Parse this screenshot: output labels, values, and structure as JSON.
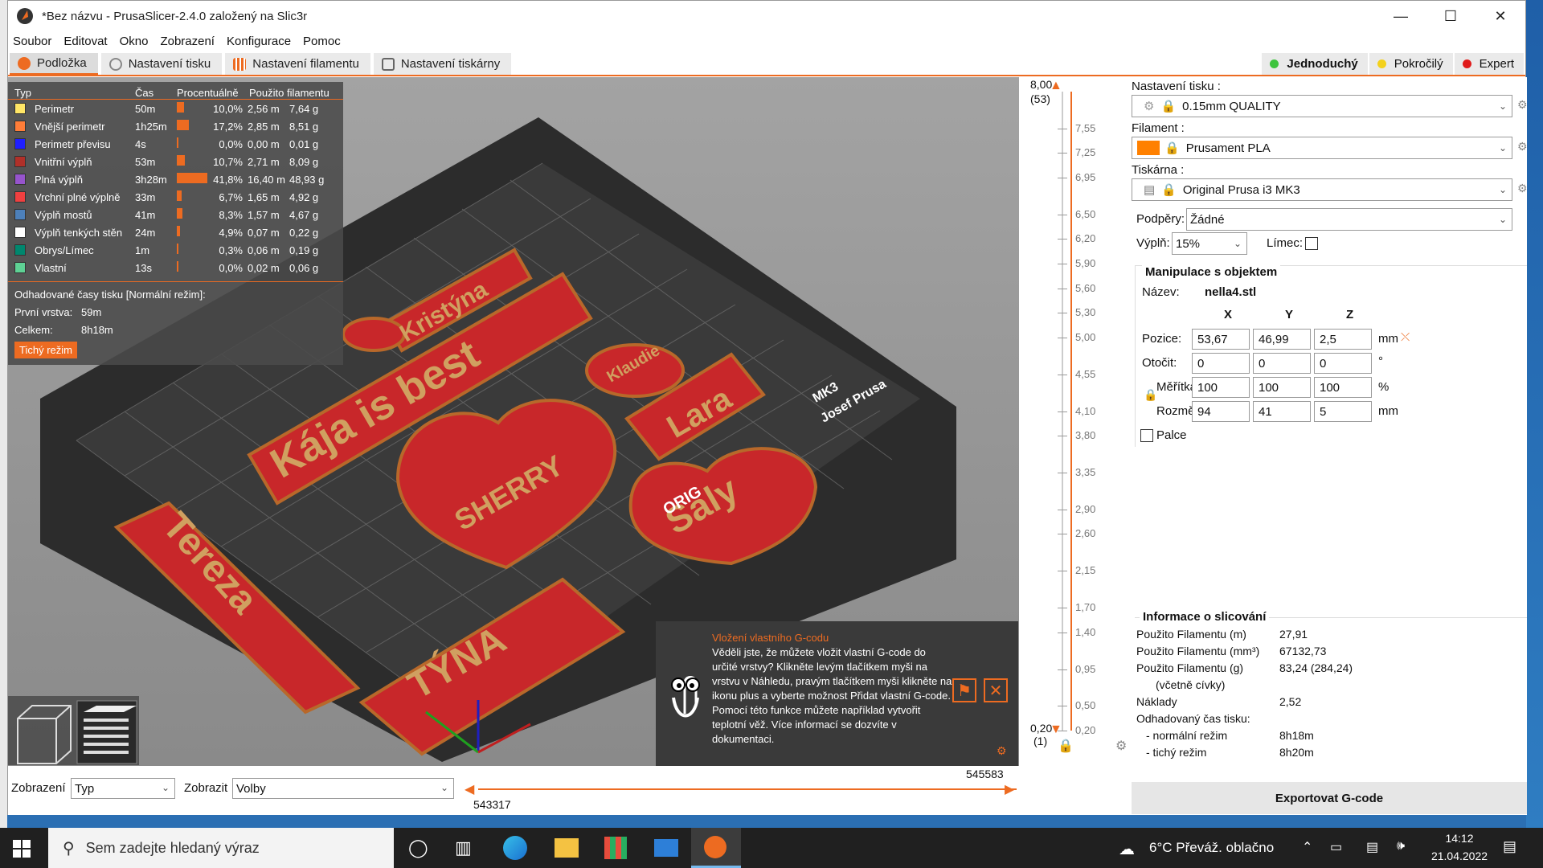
{
  "window": {
    "title": "*Bez názvu - PrusaSlicer-2.4.0 založený na Slic3r"
  },
  "menu": [
    "Soubor",
    "Editovat",
    "Okno",
    "Zobrazení",
    "Konfigurace",
    "Pomoc"
  ],
  "tabs": [
    "Podložka",
    "Nastavení tisku",
    "Nastavení filamentu",
    "Nastavení tiskárny"
  ],
  "modes": [
    {
      "label": "Jednoduchý",
      "color": "#3ec43e"
    },
    {
      "label": "Pokročilý",
      "color": "#f3d11c"
    },
    {
      "label": "Expert",
      "color": "#e01b1b"
    }
  ],
  "legend": {
    "headers": [
      "Typ",
      "Čas",
      "Procentuálně",
      "Použito filamentu"
    ],
    "rows": [
      {
        "type": "Perimetr",
        "color": "#ffe666",
        "time": "50m",
        "pct": "10,0%",
        "pct_value": 10.0,
        "length": "2,56 m",
        "weight": "7,64 g"
      },
      {
        "type": "Vnější perimetr",
        "color": "#ff7d38",
        "time": "1h25m",
        "pct": "17,2%",
        "pct_value": 17.2,
        "length": "2,85 m",
        "weight": "8,51 g"
      },
      {
        "type": "Perimetr převisu",
        "color": "#1f1fff",
        "time": "4s",
        "pct": "0,0%",
        "pct_value": 0.0,
        "length": "0,00 m",
        "weight": "0,01 g"
      },
      {
        "type": "Vnitřní výplň",
        "color": "#b03029",
        "time": "53m",
        "pct": "10,7%",
        "pct_value": 10.7,
        "length": "2,71 m",
        "weight": "8,09 g"
      },
      {
        "type": "Plná výplň",
        "color": "#9654cc",
        "time": "3h28m",
        "pct": "41,8%",
        "pct_value": 41.8,
        "length": "16,40 m",
        "weight": "48,93 g"
      },
      {
        "type": "Vrchní plné výplně",
        "color": "#f04040",
        "time": "33m",
        "pct": "6,7%",
        "pct_value": 6.7,
        "length": "1,65 m",
        "weight": "4,92 g"
      },
      {
        "type": "Výplň mostů",
        "color": "#4d80ba",
        "time": "41m",
        "pct": "8,3%",
        "pct_value": 8.3,
        "length": "1,57 m",
        "weight": "4,67 g"
      },
      {
        "type": "Výplň tenkých stěn",
        "color": "#ffffff",
        "time": "24m",
        "pct": "4,9%",
        "pct_value": 4.9,
        "length": "0,07 m",
        "weight": "0,22 g"
      },
      {
        "type": "Obrys/Límec",
        "color": "#00876e",
        "time": "1m",
        "pct": "0,3%",
        "pct_value": 0.3,
        "length": "0,06 m",
        "weight": "0,19 g"
      },
      {
        "type": "Vlastní",
        "color": "#5ed194",
        "time": "13s",
        "pct": "0,0%",
        "pct_value": 0.0,
        "length": "0,02 m",
        "weight": "0,06 g"
      }
    ],
    "est_title": "Odhadované časy tisku [Normální režim]:",
    "first_layer_label": "První vrstva:",
    "first_layer_value": "59m",
    "total_label": "Celkem:",
    "total_value": "8h18m",
    "silent_button": "Tichý režim"
  },
  "scene_labels": [
    "Kristýna",
    "Kája is best",
    "Klaudie",
    "Lara",
    "SHERRY",
    "Saly",
    "Tereza",
    "TÝNA",
    "MK3",
    "Josef Prusa",
    "ORIG"
  ],
  "tip": {
    "title": "Vložení vlastního G-codu",
    "text": "Věděli jste, že můžete vložit vlastní G-code do určité vrstvy? Klikněte levým tlačítkem myši na vrstvu v Náhledu, pravým tlačítkem myši klikněte na ikonu plus a vyberte možnost Přidat vlastní G-code. Pomocí této funkce můžete například vytvořit teplotní věž. Více informací se dozvíte v dokumentaci."
  },
  "bottom": {
    "view_label": "Zobrazení",
    "view_value": "Typ",
    "show_label": "Zobrazit",
    "show_value": "Volby",
    "h_slider_left": "543317",
    "h_slider_right": "545583"
  },
  "vslider": {
    "top_value": "8,00",
    "top_layer": "(53)",
    "bottom_value": "0,20",
    "bottom_layer": "(1)",
    "ticks": [
      "7,55",
      "7,25",
      "6,95",
      "6,50",
      "6,20",
      "5,90",
      "5,60",
      "5,30",
      "5,00",
      "4,55",
      "4,10",
      "3,80",
      "3,35",
      "2,90",
      "2,60",
      "2,15",
      "1,70",
      "1,40",
      "0,95",
      "0,50",
      "0,20"
    ]
  },
  "sidebar": {
    "print_label": "Nastavení tisku :",
    "print_value": "0.15mm QUALITY",
    "filament_label": "Filament :",
    "filament_value": "Prusament PLA",
    "filament_color": "#ff8000",
    "printer_label": "Tiskárna :",
    "printer_value": "Original Prusa i3 MK3",
    "supports_label": "Podpěry:",
    "supports_value": "Žádné",
    "infill_label": "Výplň:",
    "infill_value": "15%",
    "brim_label": "Límec:",
    "manip_title": "Manipulace s objektem",
    "name_label": "Název:",
    "name_value": "nella4.stl",
    "axes": [
      "X",
      "Y",
      "Z"
    ],
    "position_label": "Pozice:",
    "position": [
      "53,67",
      "46,99",
      "2,5"
    ],
    "position_unit": "mm",
    "rotation_label": "Otočit:",
    "rotation": [
      "0",
      "0",
      "0"
    ],
    "rotation_unit": "°",
    "scale_label": "Měřítka:",
    "scale": [
      "100",
      "100",
      "100"
    ],
    "scale_unit": "%",
    "size_label": "Rozměr:",
    "size": [
      "94",
      "41",
      "5"
    ],
    "size_unit": "mm",
    "inches_label": "Palce",
    "slice_title": "Informace o slicování",
    "slice_info": [
      {
        "label": "Použito Filamentu (m)",
        "value": "27,91"
      },
      {
        "label": "Použito Filamentu (mm³)",
        "value": "67132,73"
      },
      {
        "label": "Použito Filamentu (g)",
        "value": "83,24 (284,24)"
      },
      {
        "label": "(včetně cívky)",
        "value": ""
      },
      {
        "label": "Náklady",
        "value": "2,52"
      },
      {
        "label": "Odhadovaný čas tisku:",
        "value": ""
      },
      {
        "label": "- normální režim",
        "value": "8h18m"
      },
      {
        "label": "- tichý režim",
        "value": "8h20m"
      }
    ],
    "export_button": "Exportovat G-code"
  },
  "taskbar": {
    "search_placeholder": "Sem zadejte hledaný výraz",
    "weather": "6°C  Převáž. oblačno",
    "time": "14:12",
    "date": "21.04.2022"
  }
}
